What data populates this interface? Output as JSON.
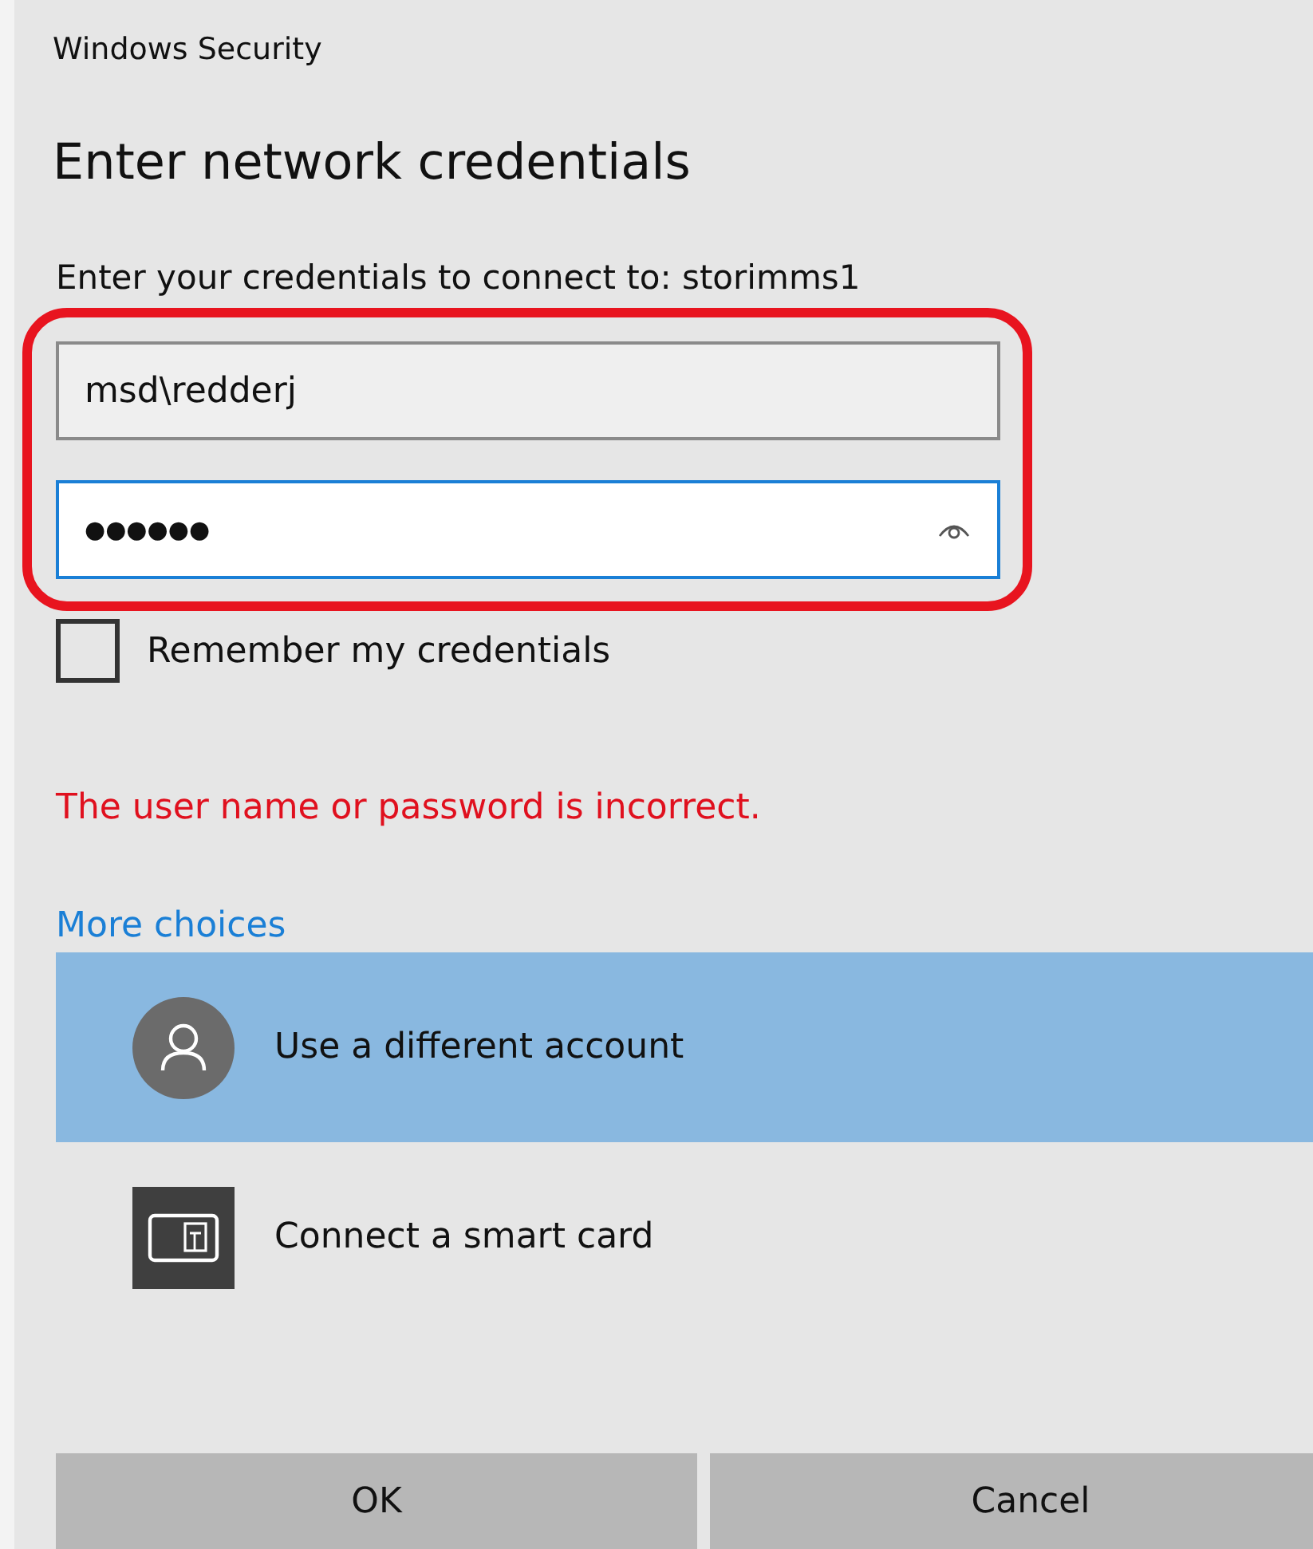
{
  "window": {
    "title": "Windows Security"
  },
  "heading": "Enter network credentials",
  "prompt": "Enter your credentials to connect to: storimms1",
  "fields": [
    {
      "kind": "text",
      "value": "msd\\redderj",
      "focused": false
    },
    {
      "kind": "password",
      "value": "●●●●●●",
      "focused": true
    }
  ],
  "annotation": {
    "kind": "outline",
    "color": "#e8141f"
  },
  "remember": {
    "label": "Remember my credentials",
    "checked": false
  },
  "error": "The user name or password is incorrect.",
  "more_choices": "More choices",
  "options": [
    {
      "kind": "account",
      "label": "Use a different account",
      "selected": true
    },
    {
      "kind": "smartcard",
      "label": "Connect a smart card",
      "selected": false
    }
  ],
  "buttons": [
    {
      "label": "OK"
    },
    {
      "label": "Cancel"
    }
  ]
}
